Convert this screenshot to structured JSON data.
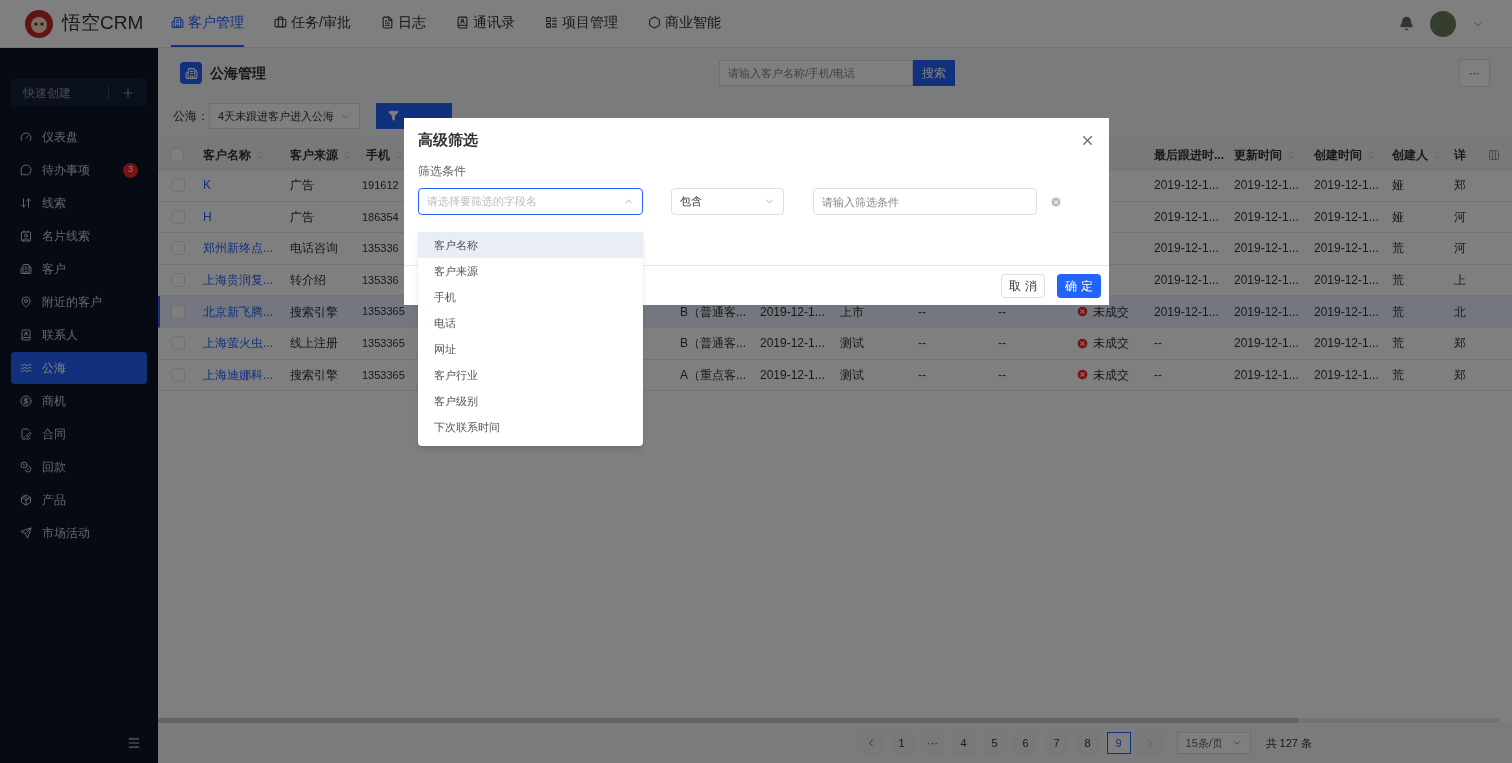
{
  "app": {
    "brand": "悟空CRM"
  },
  "top_nav": [
    {
      "label": "客户管理",
      "selected": true
    },
    {
      "label": "任务/审批",
      "selected": false
    },
    {
      "label": "日志",
      "selected": false
    },
    {
      "label": "通讯录",
      "selected": false
    },
    {
      "label": "项目管理",
      "selected": false
    },
    {
      "label": "商业智能",
      "selected": false
    }
  ],
  "sidebar": {
    "quick_create": "快速创建",
    "items": [
      {
        "label": "仪表盘",
        "selected": false
      },
      {
        "label": "待办事项",
        "selected": false,
        "badge": "3"
      },
      {
        "label": "线索",
        "selected": false
      },
      {
        "label": "名片线索",
        "selected": false
      },
      {
        "label": "客户",
        "selected": false
      },
      {
        "label": "附近的客户",
        "selected": false
      },
      {
        "label": "联系人",
        "selected": false
      },
      {
        "label": "公海",
        "selected": true
      },
      {
        "label": "商机",
        "selected": false
      },
      {
        "label": "合同",
        "selected": false
      },
      {
        "label": "回款",
        "selected": false
      },
      {
        "label": "产品",
        "selected": false
      },
      {
        "label": "市场活动",
        "selected": false
      }
    ]
  },
  "page": {
    "title": "公海管理",
    "search": {
      "placeholder": "请输入客户名称/手机/电话",
      "button": "搜索"
    },
    "more_button": "···",
    "filter": {
      "label": "公海：",
      "value": "4天未跟进客户进入公海"
    }
  },
  "table": {
    "select_all_checked": false,
    "headers": {
      "name": "客户名称",
      "source": "客户来源",
      "phone": "手机",
      "last": "最后跟进时...",
      "updated": "更新时间",
      "created": "创建时间",
      "creator": "创建人",
      "detail": "详"
    },
    "rows": [
      {
        "selected": false,
        "checked": false,
        "name": "K",
        "source": "广告",
        "phone": "191612",
        "last": "2019-12-1...",
        "updated": "2019-12-1...",
        "created": "2019-12-1...",
        "creator": "娅",
        "detail": "郑"
      },
      {
        "selected": false,
        "checked": false,
        "name": "H",
        "source": "广告",
        "phone": "186354",
        "last": "2019-12-1...",
        "updated": "2019-12-1...",
        "created": "2019-12-1...",
        "creator": "娅",
        "detail": "河"
      },
      {
        "selected": false,
        "checked": false,
        "name": "郑州新终点...",
        "source": "电话咨询",
        "phone": "135336",
        "last": "2019-12-1...",
        "updated": "2019-12-1...",
        "created": "2019-12-1...",
        "creator": "荒",
        "detail": "河"
      },
      {
        "selected": false,
        "checked": false,
        "name": "上海贵润复...",
        "source": "转介绍",
        "phone": "135336",
        "last": "2019-12-1...",
        "updated": "2019-12-1...",
        "created": "2019-12-1...",
        "creator": "荒",
        "detail": "上"
      },
      {
        "selected": true,
        "checked": false,
        "name": "北京新飞腾...",
        "source": "搜索引擎",
        "phone": "1353365",
        "level": "B（普通客...",
        "date": "2019-12-1...",
        "industry": "上市",
        "col_9": "--",
        "col_10": "--",
        "status": "未成交",
        "last": "2019-12-1...",
        "updated": "2019-12-1...",
        "created": "2019-12-1...",
        "creator": "荒",
        "detail": "北"
      },
      {
        "selected": false,
        "checked": false,
        "name": "上海萤火虫...",
        "source": "线上注册",
        "phone": "1353365",
        "level": "B（普通客...",
        "date": "2019-12-1...",
        "industry": "测试",
        "col_9": "--",
        "col_10": "--",
        "status": "未成交",
        "last": "--",
        "updated": "2019-12-1...",
        "created": "2019-12-1...",
        "creator": "荒",
        "detail": "郑"
      },
      {
        "selected": false,
        "checked": false,
        "name": "上海迪娜科...",
        "source": "搜索引擎",
        "phone": "1353365",
        "level": "A（重点客...",
        "date": "2019-12-1...",
        "industry": "测试",
        "col_9": "--",
        "col_10": "--",
        "status": "未成交",
        "last": "--",
        "updated": "2019-12-1...",
        "created": "2019-12-1...",
        "creator": "荒",
        "detail": "郑"
      }
    ]
  },
  "pagination": {
    "pages": [
      {
        "label": "1",
        "selected": false
      },
      {
        "label": "···",
        "selected": false
      },
      {
        "label": "4",
        "selected": false
      },
      {
        "label": "5",
        "selected": false
      },
      {
        "label": "6",
        "selected": false
      },
      {
        "label": "7",
        "selected": false
      },
      {
        "label": "8",
        "selected": false
      },
      {
        "label": "9",
        "selected": true
      }
    ],
    "page_size": "15条/页",
    "total": "共 127 条"
  },
  "dialog": {
    "title": "高级筛选",
    "section_label": "筛选条件",
    "field_select": {
      "placeholder": "请选择要筛选的字段名",
      "expanded": true
    },
    "operator_select": {
      "value": "包含"
    },
    "value_input": {
      "placeholder": "请输入筛选条件"
    },
    "field_options": [
      {
        "label": "客户名称",
        "highlighted": true
      },
      {
        "label": "客户来源",
        "highlighted": false
      },
      {
        "label": "手机",
        "highlighted": false
      },
      {
        "label": "电话",
        "highlighted": false
      },
      {
        "label": "网址",
        "highlighted": false
      },
      {
        "label": "客户行业",
        "highlighted": false
      },
      {
        "label": "客户级别",
        "highlighted": false
      },
      {
        "label": "下次联系时间",
        "highlighted": false
      }
    ],
    "buttons": {
      "cancel": "取 消",
      "confirm": "确 定"
    }
  }
}
